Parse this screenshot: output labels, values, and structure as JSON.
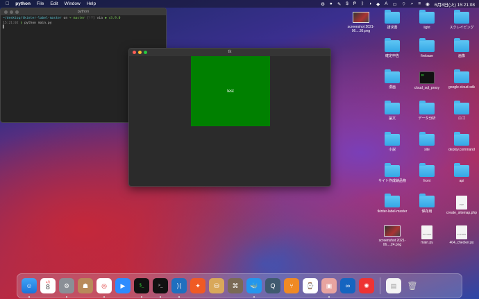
{
  "menubar": {
    "app_name": "python",
    "menus": [
      "File",
      "Edit",
      "Window",
      "Help"
    ],
    "clock": "6月8日(火) 15:21:08",
    "status_label": "A"
  },
  "terminal": {
    "title": "python",
    "line1_path": "~/desktop/tkinter-label-master",
    "line1_on": "on",
    "line1_branch": "master",
    "line1_status": "[!?]",
    "line1_via": "via",
    "line1_version": "v3.9.0",
    "line2_time": "15:21:02",
    "line2_cmd": "python main.py",
    "line3": "▌"
  },
  "tk_window": {
    "title": "tk",
    "label_text": "test"
  },
  "desktop": {
    "items": [
      {
        "label": "screenshot 2021-06....36.png",
        "kind": "thumb"
      },
      {
        "label": "請求書",
        "kind": "folder"
      },
      {
        "label": "light",
        "kind": "folder"
      },
      {
        "label": "スクレイピング",
        "kind": "folder"
      },
      {
        "label": "確定申告",
        "kind": "folder"
      },
      {
        "label": "firebase",
        "kind": "folder"
      },
      {
        "label": "画像",
        "kind": "folder"
      },
      {
        "label": "漫画",
        "kind": "folder"
      },
      {
        "label": "cloud_sql_proxy",
        "kind": "exec"
      },
      {
        "label": "google-cloud-sdk",
        "kind": "folder"
      },
      {
        "label": "論文",
        "kind": "folder"
      },
      {
        "label": "データ分析",
        "kind": "folder"
      },
      {
        "label": "ロゴ",
        "kind": "folder"
      },
      {
        "label": "小説",
        "kind": "folder"
      },
      {
        "label": "site",
        "kind": "folder"
      },
      {
        "label": "deploy.command",
        "kind": "folder"
      },
      {
        "label": "サイト作成納品物",
        "kind": "folder"
      },
      {
        "label": "front",
        "kind": "folder"
      },
      {
        "label": "api",
        "kind": "folder"
      },
      {
        "label": "tkinter-label-master",
        "kind": "folder"
      },
      {
        "label": "保存用",
        "kind": "folder"
      },
      {
        "label": "create_sitemap.php",
        "kind": "doc",
        "badge": "PHP"
      },
      {
        "label": "screenshot 2021-06....24.png",
        "kind": "thumb"
      },
      {
        "label": "main.py",
        "kind": "doc",
        "badge": "PYTHON"
      },
      {
        "label": "404_checker.py",
        "kind": "doc",
        "badge": "PYTHON"
      }
    ]
  },
  "dock": {
    "calendar_month": "6月",
    "calendar_day": "8"
  }
}
